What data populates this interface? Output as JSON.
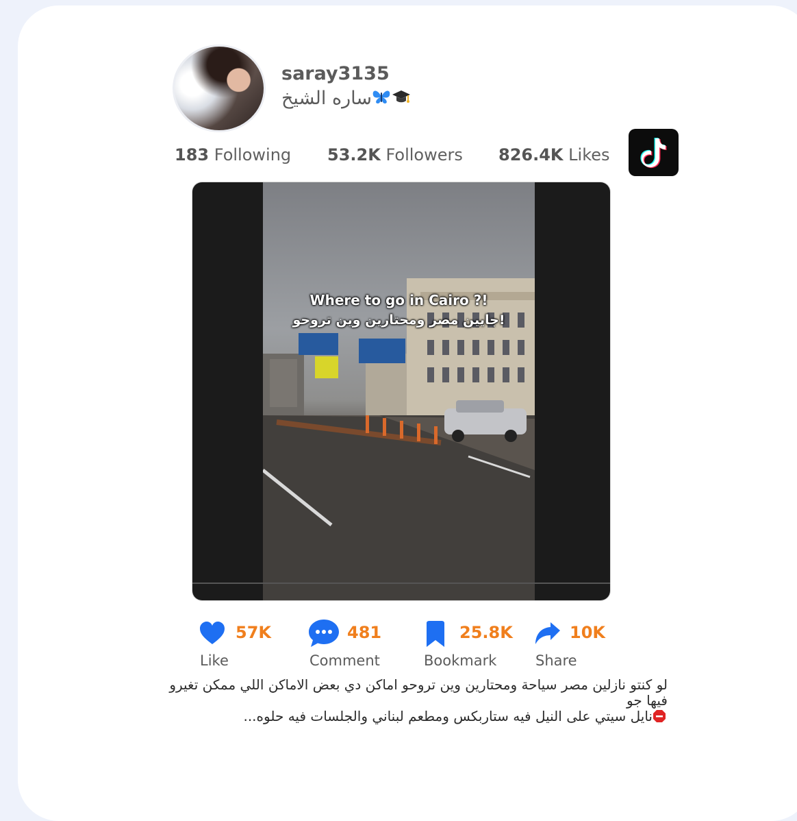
{
  "profile": {
    "username": "saray3135",
    "display_name": "ساره الشيخ",
    "display_name_emojis": [
      "graduation-cap",
      "butterfly"
    ],
    "avatar_icon": "profile-photo"
  },
  "stats": {
    "following_count": "183",
    "following_label": "Following",
    "followers_count": "53.2K",
    "followers_label": "Followers",
    "likes_count": "826.4K",
    "likes_label": "Likes"
  },
  "brand": {
    "icon": "tiktok-logo-icon",
    "background": "#0c0c0c",
    "accent_cyan": "#25f4ee",
    "accent_red": "#fe2c55"
  },
  "video": {
    "overlay_text_en": "Where to go in Cairo ?!",
    "overlay_text_ar": "جايين مصر ومحتارين وين تروحو!"
  },
  "metrics": [
    {
      "icon": "heart-icon",
      "count": "57K",
      "label": "Like"
    },
    {
      "icon": "comment-icon",
      "count": "481",
      "label": "Comment"
    },
    {
      "icon": "bookmark-icon",
      "count": "25.8K",
      "label": "Bookmark"
    },
    {
      "icon": "share-icon",
      "count": "10K",
      "label": "Share"
    }
  ],
  "colors": {
    "metric_icon": "#1e6ff2",
    "metric_count": "#f07f1d",
    "page_background": "#eef2fb",
    "card_background": "#ffffff"
  },
  "caption": {
    "line1": "لو كنتو نازلين مصر سياحة ومحتارين وين تروحو اماكن دي بعض الاماكن اللي ممكن تغيرو فيها جو",
    "line2": "نايل سيتي على النيل فيه ستاربكس ومطعم لبناني والجلسات فيه حلوه...",
    "line2_icon": "stop-sign-icon"
  }
}
